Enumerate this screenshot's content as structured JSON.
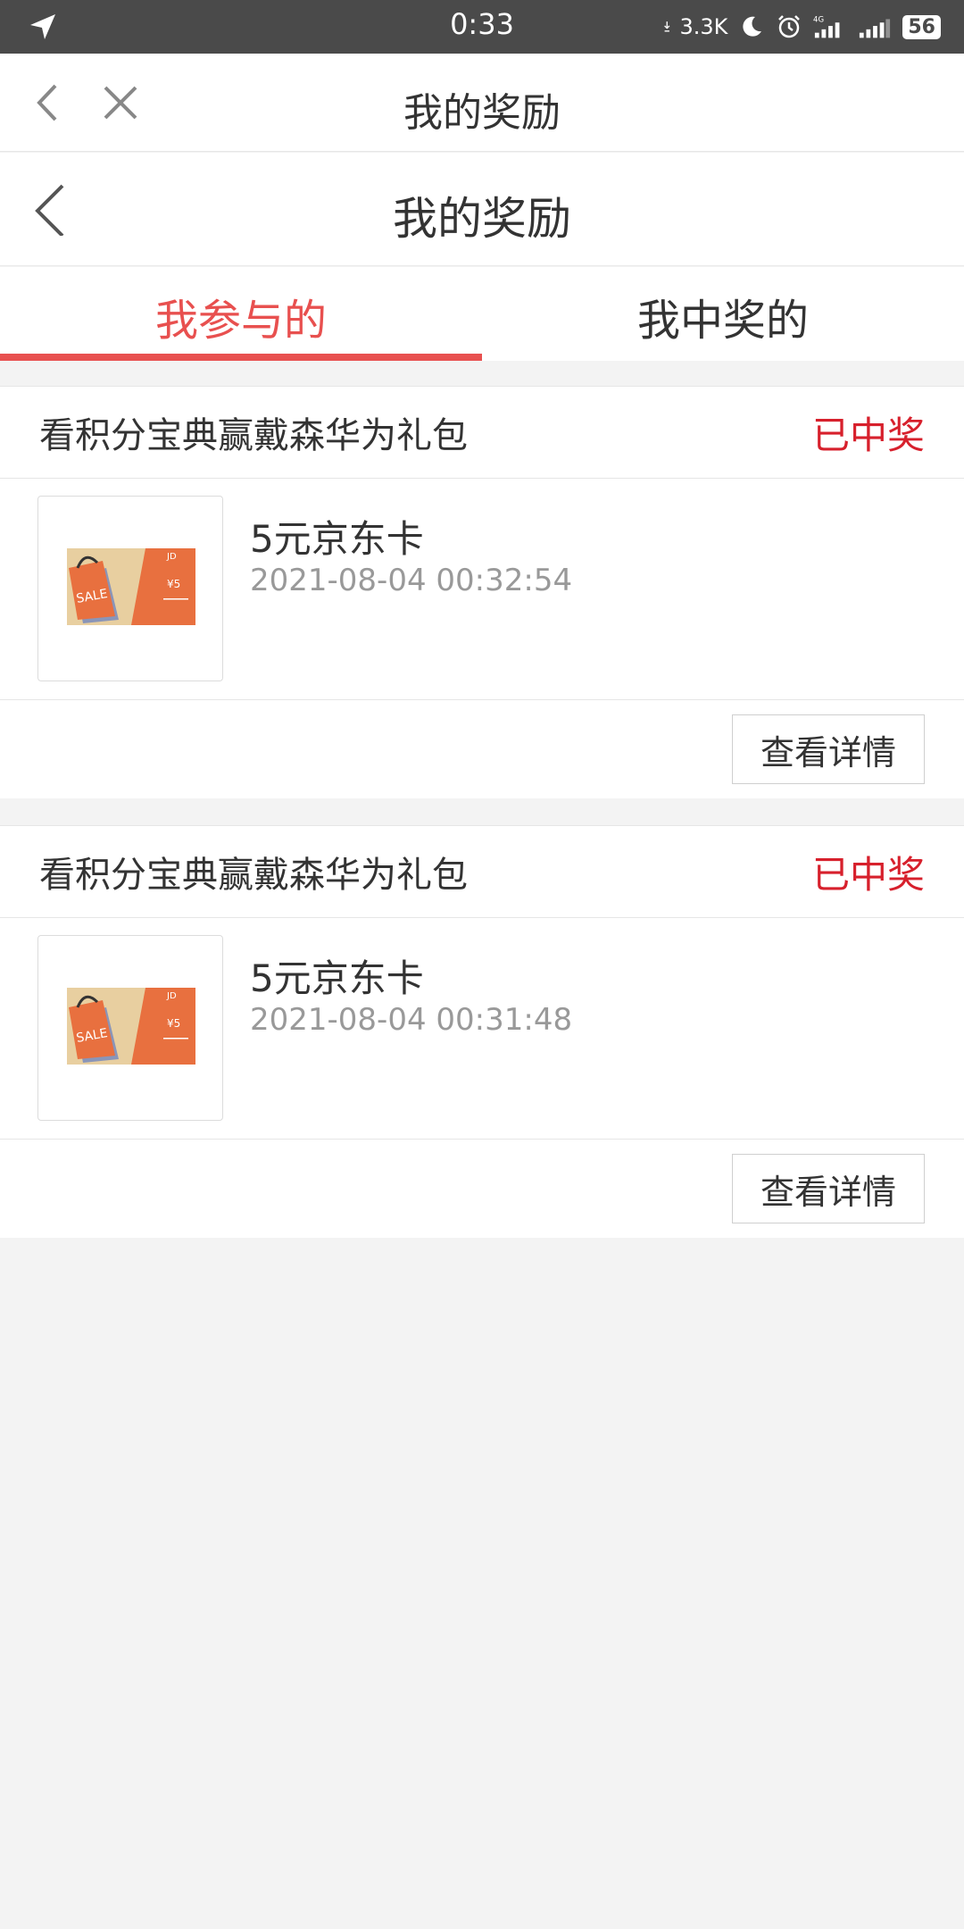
{
  "status_bar": {
    "time": "0:33",
    "net_speed": "3.3K",
    "battery": "56",
    "icons": [
      "location-arrow-icon",
      "download-icon",
      "moon-icon",
      "alarm-icon",
      "signal-4g-icon",
      "signal-icon",
      "battery-icon"
    ]
  },
  "header": {
    "title": "我的奖励"
  },
  "subheader": {
    "title": "我的奖励"
  },
  "tabs": [
    {
      "label": "我参与的",
      "active": true
    },
    {
      "label": "我中奖的",
      "active": false
    }
  ],
  "records": [
    {
      "activity": "看积分宝典赢戴森华为礼包",
      "status": "已中奖",
      "prize": "5元京东卡",
      "time": "2021-08-04 00:32:54",
      "action": "查看详情"
    },
    {
      "activity": "看积分宝典赢戴森华为礼包",
      "status": "已中奖",
      "prize": "5元京东卡",
      "time": "2021-08-04 00:31:48",
      "action": "查看详情"
    }
  ],
  "colors": {
    "accent": "#e8504f",
    "status_won": "#d7202c",
    "background": "#f3f3f3"
  }
}
